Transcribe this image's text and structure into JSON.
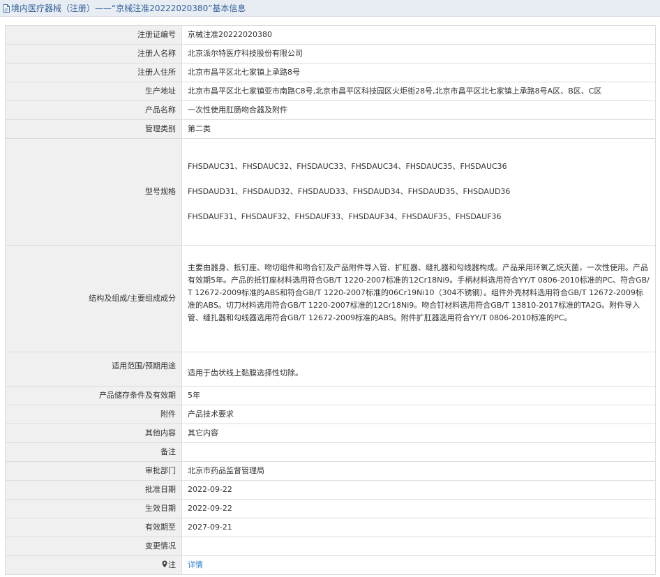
{
  "header": {
    "title": "境内医疗器械（注册）——“京械注准20222020380”基本信息",
    "icon": "document-icon"
  },
  "rows": [
    {
      "label": "注册证编号",
      "value": "京械注准20222020380"
    },
    {
      "label": "注册人名称",
      "value": "北京派尔特医疗科技股份有限公司"
    },
    {
      "label": "注册人住所",
      "value": "北京市昌平区北七家镇上承路8号"
    },
    {
      "label": "生产地址",
      "value": "北京市昌平区北七家镇亚市南路C8号,北京市昌平区科技园区火炬街28号,北京市昌平区北七家镇上承路8号A区、B区、C区"
    },
    {
      "label": "产品名称",
      "value": "一次性使用肛肠吻合器及附件"
    },
    {
      "label": "管理类别",
      "value": "第二类"
    },
    {
      "label": "型号规格",
      "lines": [
        "FHSDAUC31、FHSDAUC32、FHSDAUC33、FHSDAUC34、FHSDAUC35、FHSDAUC36",
        "FHSDAUD31、FHSDAUD32、FHSDAUD33、FHSDAUD34、FHSDAUD35、FHSDAUD36",
        "FHSDAUF31、FHSDAUF32、FHSDAUF33、FHSDAUF34、FHSDAUF35、FHSDAUF36"
      ]
    },
    {
      "label": "结构及组成/主要组成成分",
      "value": "主要由器身、抵钉座、吻切组件和吻合钉及产品附件导入管、扩肛器、缝扎器和勾线器构成。产品采用环氧乙烷灭菌，一次性使用。产品有效期5年。产品的抵钉座材料选用符合GB/T 1220-2007标准的12Cr18Ni9。手柄材料选用符合YY/T 0806-2010标准的PC、符合GB/T 12672-2009标准的ABS和符合GB/T 1220-2007标准的06Cr19Ni10（304不锈钢）。组件外壳材料选用符合GB/T 12672-2009标准的ABS。切刀材料选用符合GB/T 1220-2007标准的12Cr18Ni9。吻合钉材料选用符合GB/T 13810-2017标准的TA2G。附件导入管、缝扎器和勾线器选用符合GB/T 12672-2009标准的ABS。附件扩肛器选用符合YY/T 0806-2010标准的PC。"
    },
    {
      "label": "适用范围/预期用途",
      "value": "适用于齿状线上黏膜选择性切除。"
    },
    {
      "label": "产品储存条件及有效期",
      "value": "5年"
    },
    {
      "label": "附件",
      "value": "产品技术要求"
    },
    {
      "label": "其他内容",
      "value": "其它内容"
    },
    {
      "label": "备注",
      "value": ""
    },
    {
      "label": "审批部门",
      "value": "北京市药品监督管理局"
    },
    {
      "label": "批准日期",
      "value": "2022-09-22"
    },
    {
      "label": "生效日期",
      "value": "2022-09-22"
    },
    {
      "label": "有效期至",
      "value": "2027-09-21"
    },
    {
      "label": "变更情况",
      "value": ""
    },
    {
      "label": "注",
      "value": "详情",
      "icon": "location-pin-icon",
      "link_color": "#2f7fd0"
    }
  ],
  "colors": {
    "header_bg": "#e8edf3",
    "header_text": "#2f5f9a",
    "label_bg": "#f0f0f0",
    "border": "#dcdcdc",
    "link": "#2f7fd0"
  }
}
